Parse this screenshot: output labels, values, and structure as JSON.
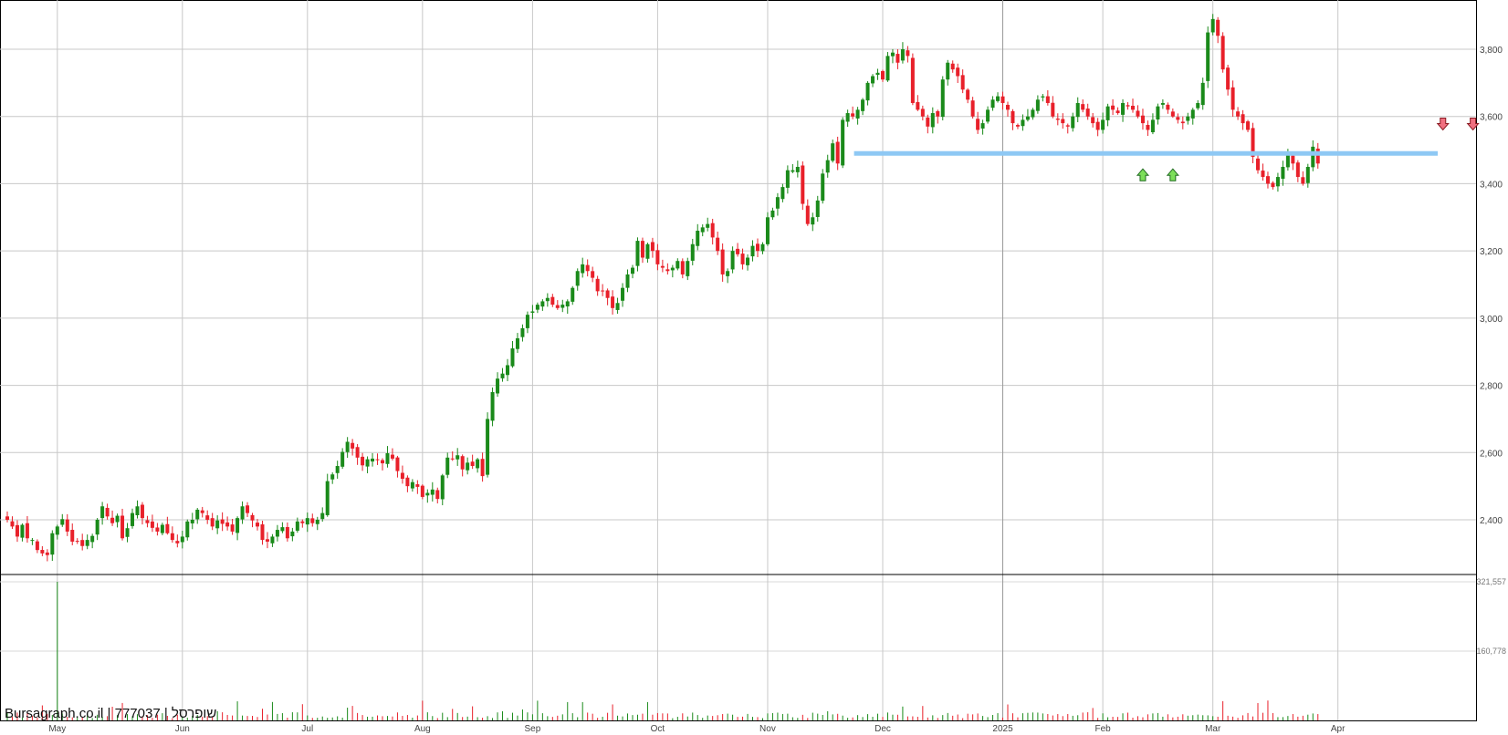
{
  "chart_data": {
    "type": "candlestick",
    "y_ticks": [
      "3,800",
      "3,600",
      "3,400",
      "3,200",
      "3,000",
      "2,800",
      "2,600",
      "2,400"
    ],
    "y_tick_values": [
      3800,
      3600,
      3400,
      3200,
      3000,
      2800,
      2600,
      2400
    ],
    "ylim": [
      2250,
      3950
    ],
    "volume_ticks": [
      "321,557",
      "160,778"
    ],
    "volume_tick_values": [
      321557,
      160778
    ],
    "x_labels": [
      "May",
      "Jun",
      "Jul",
      "Aug",
      "Sep",
      "Oct",
      "Nov",
      "Dec",
      "2025",
      "Feb",
      "Mar",
      "Apr"
    ],
    "x_label_bar_index": [
      10,
      35,
      60,
      83,
      105,
      130,
      152,
      175,
      199,
      219,
      241,
      266
    ],
    "support_level": 3490,
    "support_start_bar": 170,
    "up_color": "#1a8a1a",
    "down_color": "#e8202a",
    "support_color": "#8ec8f4",
    "buy_arrow_color": "#7ddf5a",
    "sell_arrow_color": "#f07080",
    "buy_signals": [
      {
        "bar": 227,
        "price": 3444
      },
      {
        "bar": 233,
        "price": 3444
      }
    ],
    "sell_signals": [
      {
        "bar": 287,
        "price": 3560
      },
      {
        "bar": 293,
        "price": 3560
      }
    ],
    "closes": [
      2400,
      2380,
      2350,
      2385,
      2345,
      2340,
      2310,
      2300,
      2295,
      2360,
      2380,
      2402,
      2365,
      2335,
      2335,
      2322,
      2340,
      2352,
      2400,
      2440,
      2410,
      2390,
      2412,
      2345,
      2375,
      2420,
      2440,
      2405,
      2390,
      2376,
      2365,
      2385,
      2360,
      2340,
      2330,
      2350,
      2395,
      2400,
      2430,
      2420,
      2400,
      2380,
      2398,
      2388,
      2380,
      2365,
      2405,
      2440,
      2420,
      2398,
      2380,
      2340,
      2335,
      2350,
      2370,
      2378,
      2345,
      2365,
      2395,
      2390,
      2405,
      2390,
      2400,
      2420,
      2515,
      2535,
      2560,
      2602,
      2632,
      2612,
      2585,
      2562,
      2580,
      2582,
      2578,
      2568,
      2598,
      2582,
      2545,
      2522,
      2500,
      2512,
      2498,
      2468,
      2480,
      2490,
      2462,
      2532,
      2585,
      2580,
      2592,
      2550,
      2570,
      2560,
      2580,
      2530,
      2700,
      2780,
      2820,
      2835,
      2860,
      2910,
      2940,
      2970,
      3010,
      3020,
      3040,
      3050,
      3060,
      3040,
      3030,
      3040,
      3050,
      3090,
      3140,
      3160,
      3140,
      3120,
      3080,
      3080,
      3060,
      3030,
      3045,
      3090,
      3130,
      3150,
      3230,
      3180,
      3220,
      3200,
      3160,
      3150,
      3140,
      3150,
      3170,
      3130,
      3170,
      3220,
      3260,
      3270,
      3280,
      3240,
      3200,
      3130,
      3140,
      3200,
      3190,
      3160,
      3180,
      3215,
      3200,
      3220,
      3300,
      3320,
      3360,
      3390,
      3440,
      3440,
      3450,
      3340,
      3280,
      3300,
      3350,
      3430,
      3470,
      3520,
      3460,
      3590,
      3610,
      3600,
      3620,
      3650,
      3700,
      3720,
      3730,
      3710,
      3780,
      3790,
      3760,
      3800,
      3780,
      3640,
      3620,
      3600,
      3570,
      3610,
      3600,
      3710,
      3760,
      3740,
      3720,
      3680,
      3650,
      3600,
      3560,
      3580,
      3620,
      3650,
      3660,
      3640,
      3620,
      3580,
      3570,
      3590,
      3600,
      3620,
      3650,
      3660,
      3640,
      3600,
      3590,
      3580,
      3570,
      3600,
      3640,
      3620,
      3600,
      3580,
      3560,
      3590,
      3630,
      3620,
      3610,
      3640,
      3630,
      3620,
      3600,
      3580,
      3560,
      3590,
      3630,
      3640,
      3620,
      3600,
      3590,
      3580,
      3600,
      3620,
      3640,
      3700,
      3850,
      3890,
      3840,
      3740,
      3680,
      3620,
      3600,
      3580,
      3560,
      3480,
      3440,
      3420,
      3400,
      3390,
      3420,
      3450,
      3490,
      3460,
      3420,
      3400,
      3450,
      3510,
      3460
    ]
  },
  "branding": {
    "text": "Bursagraph.co.il | 777037 | שופרסל"
  }
}
